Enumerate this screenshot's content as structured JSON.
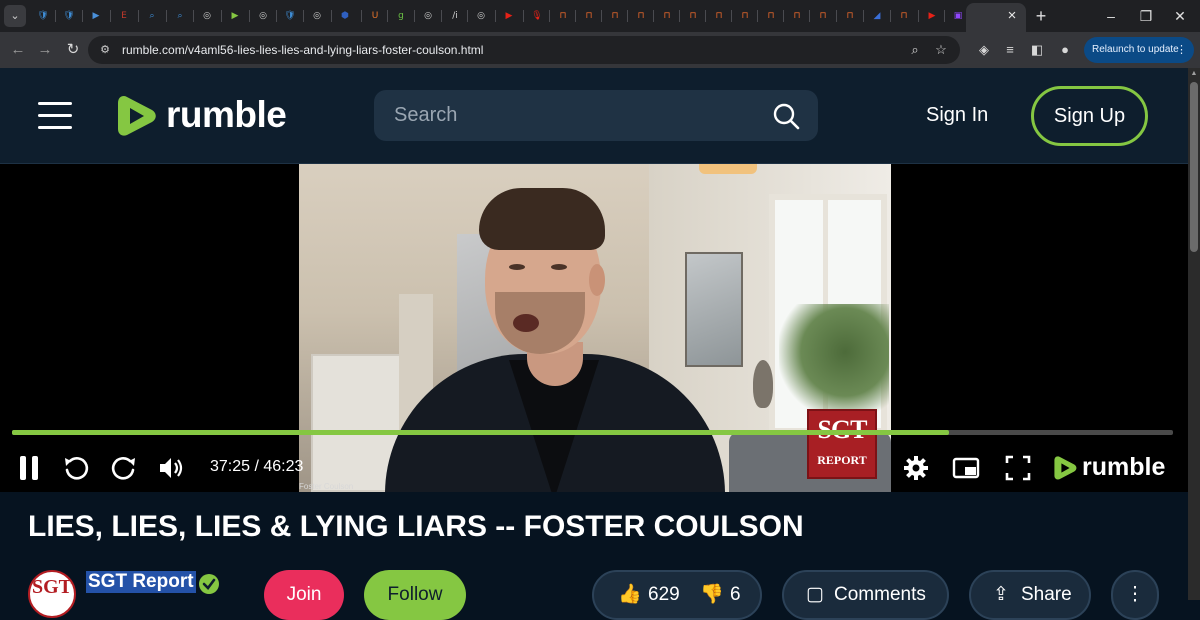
{
  "browser": {
    "favicons": [
      {
        "name": "shield-favicon",
        "glyph": "🛡",
        "color": "#3f8fd8"
      },
      {
        "name": "shield-favicon",
        "glyph": "🛡",
        "color": "#3f8fd8"
      },
      {
        "name": "play-favicon",
        "glyph": "▶",
        "color": "#4a90d9"
      },
      {
        "name": "news-favicon",
        "glyph": "E",
        "color": "#c0392b"
      },
      {
        "name": "search-favicon",
        "glyph": "⌕",
        "color": "#3f8fd8"
      },
      {
        "name": "search-favicon",
        "glyph": "⌕",
        "color": "#3f8fd8"
      },
      {
        "name": "globe-favicon",
        "glyph": "◎",
        "color": "#cfcfcf"
      },
      {
        "name": "rumble-favicon",
        "glyph": "▶",
        "color": "#85c742"
      },
      {
        "name": "globe-favicon",
        "glyph": "◎",
        "color": "#cfcfcf"
      },
      {
        "name": "shield-favicon",
        "glyph": "🛡",
        "color": "#3f8fd8"
      },
      {
        "name": "globe-favicon",
        "glyph": "◎",
        "color": "#cfcfcf"
      },
      {
        "name": "hex-favicon",
        "glyph": "⬢",
        "color": "#2f5fbf"
      },
      {
        "name": "shield-favicon",
        "glyph": "U",
        "color": "#e8742a"
      },
      {
        "name": "g-favicon",
        "glyph": "g",
        "color": "#6ac044"
      },
      {
        "name": "globe-favicon",
        "glyph": "◎",
        "color": "#cfcfcf"
      },
      {
        "name": "text-favicon",
        "glyph": "/i",
        "color": "#cfcfcf"
      },
      {
        "name": "globe-favicon",
        "glyph": "◎",
        "color": "#cfcfcf"
      },
      {
        "name": "youtube-favicon",
        "glyph": "▶",
        "color": "#e62117"
      },
      {
        "name": "mic-favicon",
        "glyph": "🎙",
        "color": "#e62117"
      },
      {
        "name": "bookmark-favicon",
        "glyph": "⊓",
        "color": "#ef6b2c"
      },
      {
        "name": "bookmark-favicon",
        "glyph": "⊓",
        "color": "#ef6b2c"
      },
      {
        "name": "bookmark-favicon",
        "glyph": "⊓",
        "color": "#ef6b2c"
      },
      {
        "name": "bookmark-favicon",
        "glyph": "⊓",
        "color": "#ef6b2c"
      },
      {
        "name": "bookmark-favicon",
        "glyph": "⊓",
        "color": "#ef6b2c"
      },
      {
        "name": "bookmark-favicon",
        "glyph": "⊓",
        "color": "#ef6b2c"
      },
      {
        "name": "bookmark-favicon",
        "glyph": "⊓",
        "color": "#ef6b2c"
      },
      {
        "name": "bookmark-favicon",
        "glyph": "⊓",
        "color": "#ef6b2c"
      },
      {
        "name": "bookmark-favicon",
        "glyph": "⊓",
        "color": "#ef6b2c"
      },
      {
        "name": "bookmark-favicon",
        "glyph": "⊓",
        "color": "#ef6b2c"
      },
      {
        "name": "bookmark-favicon",
        "glyph": "⊓",
        "color": "#ef6b2c"
      },
      {
        "name": "bookmark-favicon",
        "glyph": "⊓",
        "color": "#ef6b2c"
      },
      {
        "name": "dark-favicon",
        "glyph": "◢",
        "color": "#3a6fd8"
      },
      {
        "name": "bookmark-favicon",
        "glyph": "⊓",
        "color": "#ef6b2c"
      },
      {
        "name": "youtube-favicon",
        "glyph": "▶",
        "color": "#e62117"
      },
      {
        "name": "twitch-favicon",
        "glyph": "▣",
        "color": "#9146ff"
      },
      {
        "name": "mail-favicon",
        "glyph": "✉",
        "color": "#9146ff"
      }
    ],
    "url": "rumble.com/v4aml56-lies-lies-lies-and-lying-liars-foster-coulson.html",
    "relaunch_label": "Relaunch to update",
    "relaunch_menu": "⋮"
  },
  "header": {
    "logo_text": "rumble",
    "search_placeholder": "Search",
    "sign_in": "Sign In",
    "sign_up": "Sign Up"
  },
  "player": {
    "caption": "Foster Coulson",
    "watermark_top": "SGT",
    "watermark_bottom": "REPORT",
    "time": "37:25 / 46:23",
    "progress": 0.807,
    "logo_text": "rumble"
  },
  "video": {
    "title": "LIES, LIES, LIES & LYING LIARS -- FOSTER COULSON",
    "channel": "SGT Report",
    "avatar_text": "SGT",
    "join": "Join",
    "follow": "Follow",
    "likes": "629",
    "dislikes": "6",
    "comments": "Comments",
    "share": "Share"
  },
  "colors": {
    "brand_green": "#85c742",
    "header_bg": "#0e1e2d",
    "join_pink": "#ea2e5c"
  }
}
